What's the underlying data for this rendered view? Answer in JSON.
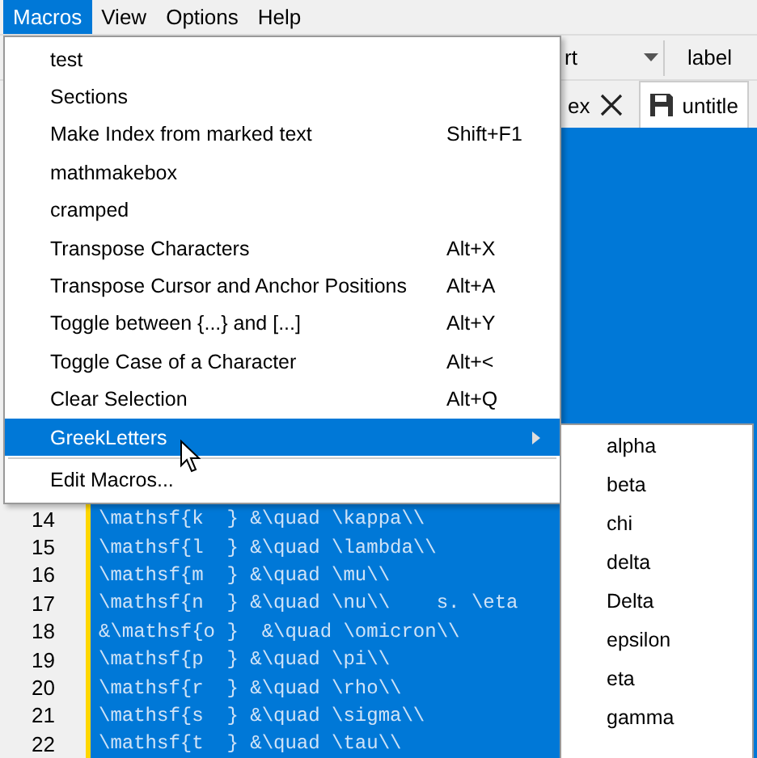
{
  "menubar": [
    {
      "label": "Macros",
      "selected": true
    },
    {
      "label": "View",
      "selected": false
    },
    {
      "label": "Options",
      "selected": false
    },
    {
      "label": "Help",
      "selected": false
    }
  ],
  "toolbar": {
    "dropdown_text": "rt",
    "label_button": "label"
  },
  "tabs": [
    {
      "label": "ex",
      "selected": false,
      "closable": true
    },
    {
      "label": "untitle",
      "selected": true,
      "closable": false
    }
  ],
  "editor": {
    "lines": [
      {
        "number": "14",
        "text": "\\mathsf{k  } &\\quad \\kappa\\\\"
      },
      {
        "number": "15",
        "text": "\\mathsf{l  } &\\quad \\lambda\\\\"
      },
      {
        "number": "16",
        "text": "\\mathsf{m  } &\\quad \\mu\\\\"
      },
      {
        "number": "17",
        "text": "\\mathsf{n  } &\\quad \\nu\\\\    s. \\eta"
      },
      {
        "number": "18",
        "text": "&\\mathsf{o }  &\\quad \\omicron\\\\"
      },
      {
        "number": "19",
        "text": "\\mathsf{p  } &\\quad \\pi\\\\"
      },
      {
        "number": "20",
        "text": "\\mathsf{r  } &\\quad \\rho\\\\"
      },
      {
        "number": "21",
        "text": "\\mathsf{s  } &\\quad \\sigma\\\\"
      },
      {
        "number": "22",
        "text": "\\mathsf{t  } &\\quad \\tau\\\\"
      }
    ]
  },
  "menu": {
    "items": [
      {
        "kind": "item",
        "label": "test",
        "selected": false
      },
      {
        "kind": "item",
        "label": "Sections",
        "selected": false
      },
      {
        "kind": "item",
        "label": "Make Index from marked text",
        "shortcut": "Shift+F1",
        "selected": false
      },
      {
        "kind": "item",
        "label": "mathmakebox",
        "selected": false
      },
      {
        "kind": "item",
        "label": "cramped",
        "selected": false
      },
      {
        "kind": "item",
        "label": "Transpose Characters",
        "shortcut": "Alt+X",
        "selected": false
      },
      {
        "kind": "item",
        "label": "Transpose Cursor and Anchor Positions",
        "shortcut": "Alt+A",
        "selected": false
      },
      {
        "kind": "item",
        "label": "Toggle between {...} and [...]",
        "shortcut": "Alt+Y",
        "selected": false
      },
      {
        "kind": "item",
        "label": "Toggle Case of a Character",
        "shortcut": "Alt+<",
        "selected": false
      },
      {
        "kind": "item",
        "label": "Clear Selection",
        "shortcut": "Alt+Q",
        "selected": false
      },
      {
        "kind": "submenu",
        "label": "GreekLetters",
        "selected": true
      },
      {
        "kind": "separator"
      },
      {
        "kind": "item",
        "label": "Edit Macros...",
        "selected": false
      }
    ]
  },
  "submenu": {
    "items": [
      "alpha",
      "beta",
      "chi",
      "delta",
      "Delta",
      "epsilon",
      "eta",
      "gamma"
    ]
  }
}
